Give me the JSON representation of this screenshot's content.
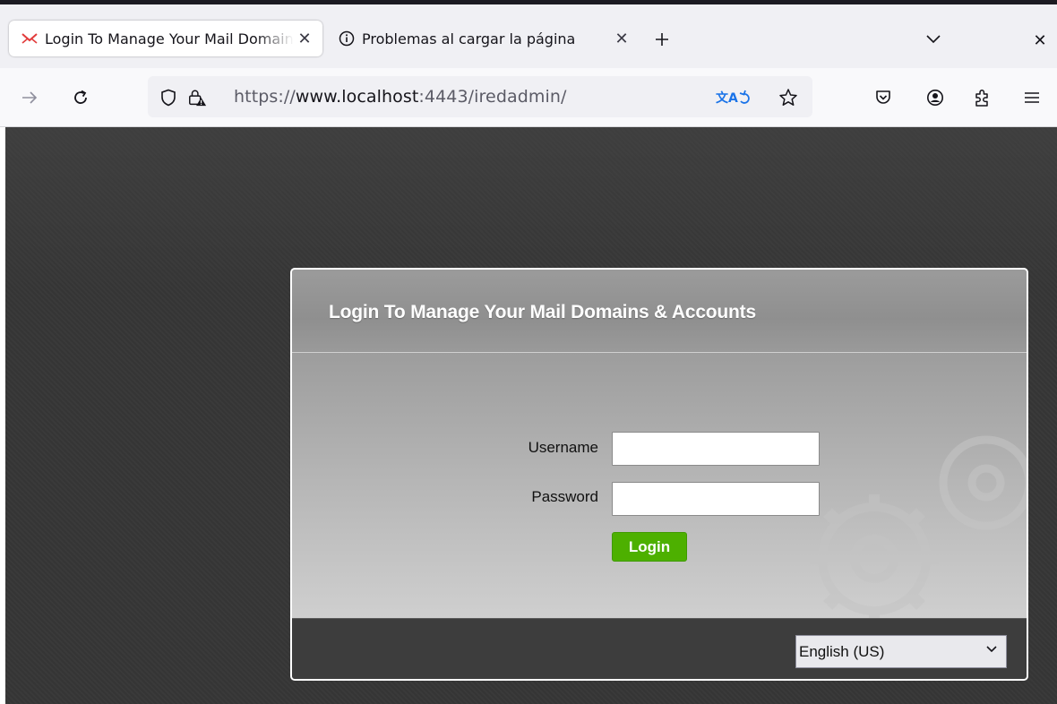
{
  "browser": {
    "tabs": [
      {
        "title": "Login To Manage Your Mail Domains & Accounts",
        "active": true,
        "icon": "iredmail-icon"
      },
      {
        "title": "Problemas al cargar la página",
        "active": false,
        "icon": "info-icon"
      }
    ],
    "url": {
      "scheme": "https://",
      "host": "www.localhost",
      "rest": ":4443/iredadmin/"
    }
  },
  "login": {
    "title": "Login To Manage Your Mail Domains & Accounts",
    "username_label": "Username",
    "username_value": "",
    "password_label": "Password",
    "password_value": "",
    "submit_label": "Login",
    "language": "English (US)"
  },
  "colors": {
    "accent_green": "#4db000",
    "page_background": "#353535",
    "footer_background": "#3d3d3d"
  }
}
